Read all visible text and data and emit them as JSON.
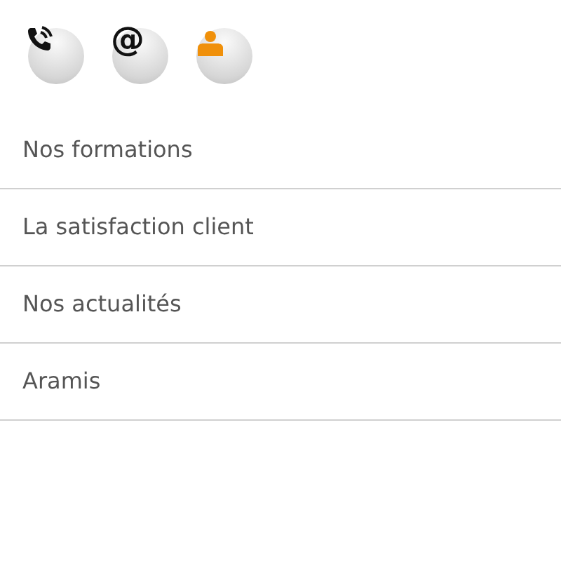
{
  "contact_icons": [
    {
      "kind": "phone"
    },
    {
      "kind": "at",
      "glyph": "@"
    },
    {
      "kind": "person"
    }
  ],
  "menu": [
    {
      "label": "Nos formations"
    },
    {
      "label": "La satisfaction client"
    },
    {
      "label": "Nos actualités"
    },
    {
      "label": "Aramis"
    }
  ]
}
